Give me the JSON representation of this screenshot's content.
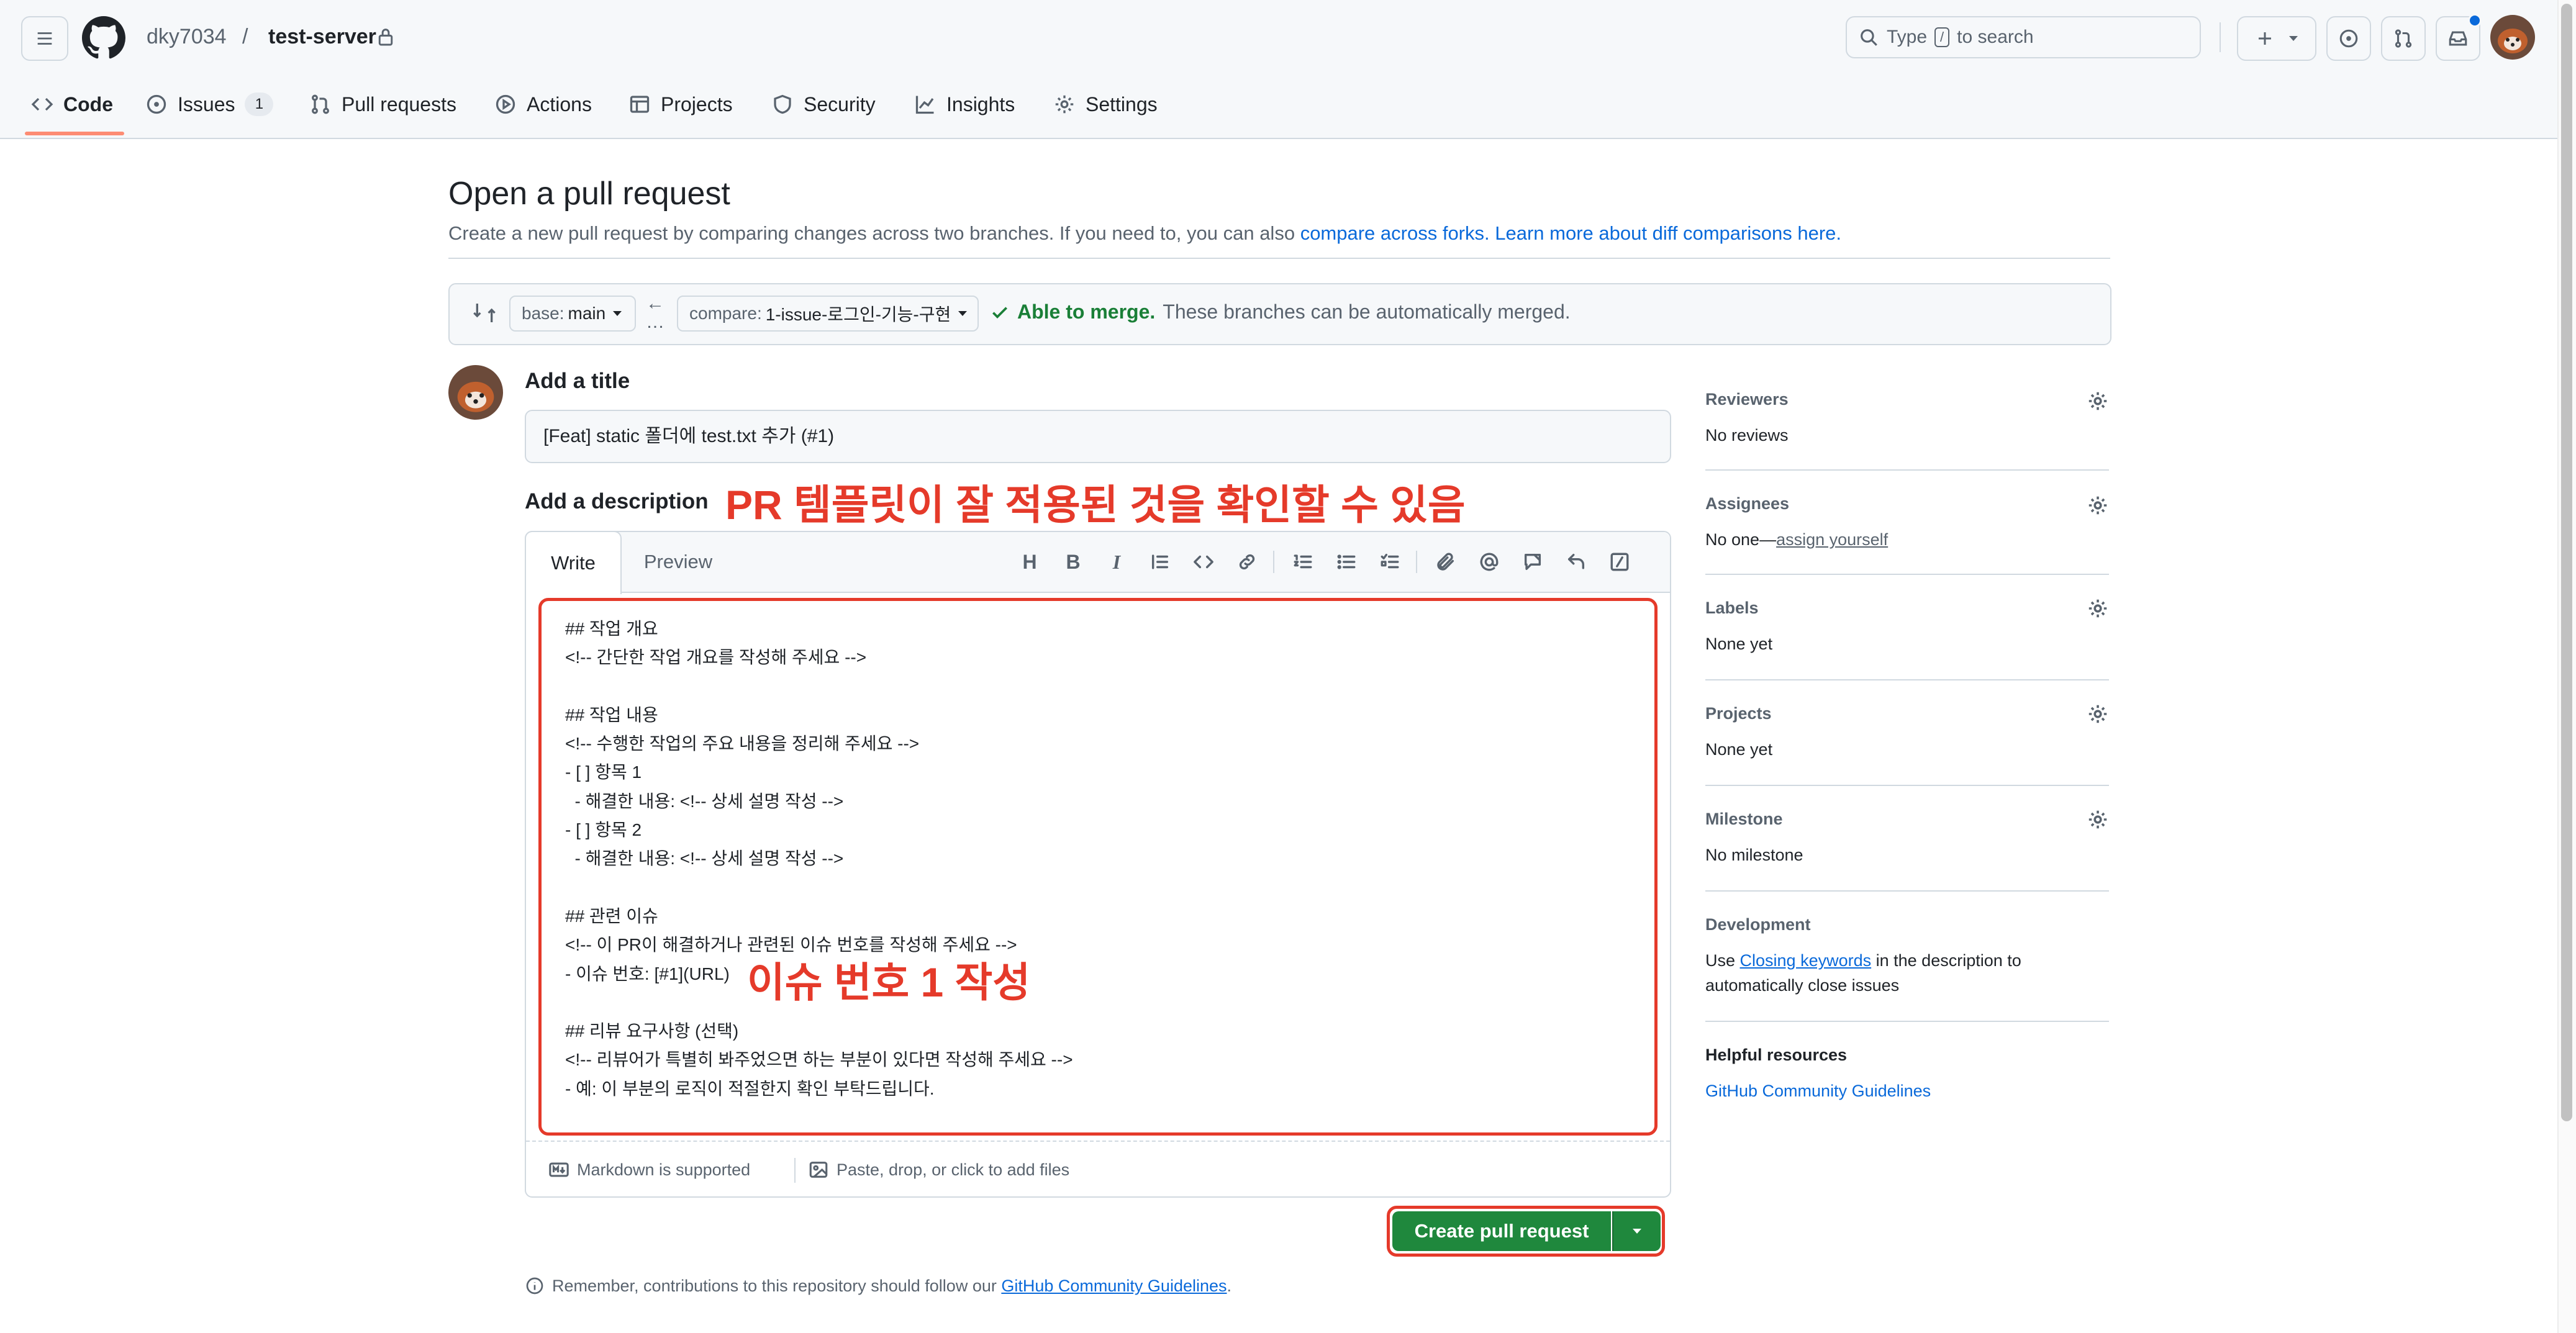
{
  "header": {
    "owner": "dky7034",
    "separator": "/",
    "repo": "test-server",
    "search_prefix": "Type",
    "search_key": "/",
    "search_suffix": "to search"
  },
  "nav": [
    {
      "label": "Code",
      "icon": "code-icon"
    },
    {
      "label": "Issues",
      "icon": "issue-icon",
      "count": "1"
    },
    {
      "label": "Pull requests",
      "icon": "pull-request-icon"
    },
    {
      "label": "Actions",
      "icon": "play-icon"
    },
    {
      "label": "Projects",
      "icon": "table-icon"
    },
    {
      "label": "Security",
      "icon": "shield-icon"
    },
    {
      "label": "Insights",
      "icon": "graph-icon"
    },
    {
      "label": "Settings",
      "icon": "gear-icon"
    }
  ],
  "page": {
    "title": "Open a pull request",
    "subtitle": "Create a new pull request by comparing changes across two branches. If you need to, you can also ",
    "link_forks": "compare across forks.",
    "link_learn": "Learn more about diff comparisons here."
  },
  "compare": {
    "base_prefix": "base:",
    "base_value": "main",
    "compare_prefix": "compare:",
    "compare_value": "1-issue-로그인-기능-구현",
    "merge_status": "Able to merge.",
    "merge_note": "These branches can be automatically merged."
  },
  "form": {
    "title_label": "Add a title",
    "title_value": "[Feat] static 폴더에 test.txt 추가 (#1)",
    "desc_label": "Add a description",
    "tab_write": "Write",
    "tab_preview": "Preview",
    "body": "## 작업 개요\n<!-- 간단한 작업 개요를 작성해 주세요 -->\n\n## 작업 내용\n<!-- 수행한 작업의 주요 내용을 정리해 주세요 -->\n- [ ] 항목 1\n  - 해결한 내용: <!-- 상세 설명 작성 -->\n- [ ] 항목 2\n  - 해결한 내용: <!-- 상세 설명 작성 -->\n\n## 관련 이슈\n<!-- 이 PR이 해결하거나 관련된 이슈 번호를 작성해 주세요 -->\n- 이슈 번호: [#1](URL)\n\n## 리뷰 요구사항 (선택)\n<!-- 리뷰어가 특별히 봐주었으면 하는 부분이 있다면 작성해 주세요 -->\n- 예: 이 부분의 로직이 적절한지 확인 부탁드립니다.",
    "markdown_note": "Markdown is supported",
    "attach_note": "Paste, drop, or click to add files",
    "create_button": "Create pull request",
    "reminder_prefix": "Remember, contributions to this repository should follow our ",
    "reminder_link": "GitHub Community Guidelines",
    "reminder_suffix": "."
  },
  "annotations": {
    "template": "PR 템플릿이 잘 적용된 것을 확인할 수 있음",
    "issue": "이슈 번호 1 작성"
  },
  "sidebar": {
    "reviewers_title": "Reviewers",
    "reviewers_value": "No reviews",
    "assignees_title": "Assignees",
    "assignees_value": "No one—",
    "assignees_link": "assign yourself",
    "labels_title": "Labels",
    "labels_value": "None yet",
    "projects_title": "Projects",
    "projects_value": "None yet",
    "milestone_title": "Milestone",
    "milestone_value": "No milestone",
    "development_title": "Development",
    "development_pre": "Use ",
    "development_link": "Closing keywords",
    "development_post": " in the description to",
    "development_line2": "automatically close issues",
    "help_title": "Helpful resources",
    "help_link": "GitHub Community Guidelines"
  },
  "colors": {
    "accent_green": "#1f883d",
    "link_blue": "#0969da",
    "annotation_red": "#e53a2a",
    "tab_underline": "#fd8c73"
  }
}
